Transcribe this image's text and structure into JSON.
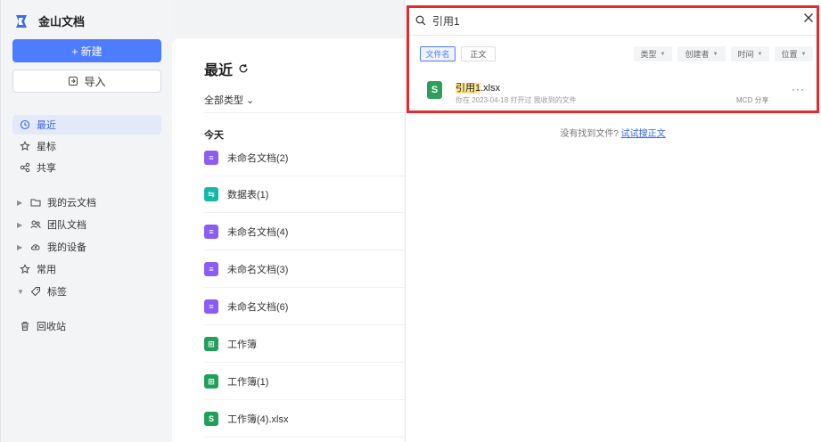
{
  "app": {
    "name": "金山文档"
  },
  "sidebar": {
    "new_label": "+ 新建",
    "import_label": "导入",
    "items": [
      {
        "label": "最近",
        "icon": "clock-icon",
        "active": true
      },
      {
        "label": "星标",
        "icon": "star-icon"
      },
      {
        "label": "共享",
        "icon": "share-icon"
      },
      {
        "label": "我的云文档",
        "icon": "folder-icon",
        "expandable": true
      },
      {
        "label": "团队文档",
        "icon": "team-icon",
        "expandable": true
      },
      {
        "label": "我的设备",
        "icon": "device-icon",
        "expandable": true
      },
      {
        "label": "常用",
        "icon": "star-outline-icon"
      },
      {
        "label": "标签",
        "icon": "tag-icon",
        "expandable": true,
        "expanded": true
      },
      {
        "label": "回收站",
        "icon": "trash-icon"
      }
    ]
  },
  "main": {
    "title": "最近",
    "type_filter": "全部类型 ⌄",
    "section_today": "今天",
    "files": [
      {
        "name": "未命名文档(2)",
        "type": "doc",
        "color": "#8b5cf6"
      },
      {
        "name": "数据表(1)",
        "type": "sheet-table",
        "color": "#14b8a6"
      },
      {
        "name": "未命名文档(4)",
        "type": "doc",
        "color": "#8b5cf6"
      },
      {
        "name": "未命名文档(3)",
        "type": "doc",
        "color": "#8b5cf6"
      },
      {
        "name": "未命名文档(6)",
        "type": "doc",
        "color": "#8b5cf6"
      },
      {
        "name": "工作簿",
        "type": "workbook",
        "color": "#22a05b"
      },
      {
        "name": "工作簿(1)",
        "type": "workbook",
        "color": "#22a05b"
      },
      {
        "name": "工作簿(4).xlsx",
        "type": "xlsx",
        "color": "#22a05b"
      }
    ]
  },
  "search": {
    "query": "引用1",
    "scope_tabs": [
      "文件名",
      "正文"
    ],
    "filters": [
      "类型",
      "创建者",
      "时间",
      "位置"
    ],
    "result": {
      "name_highlight": "引用1",
      "name_rest": ".xlsx",
      "meta": "你在 2023-04-18 打开过  我收到的文件",
      "owner": "MCD 分享",
      "more": "···"
    },
    "not_found_text": "没有找到文件?",
    "not_found_link": "试试搜正文"
  },
  "colors": {
    "accent": "#4d7cfe",
    "highlight_border": "#e02c2c"
  }
}
